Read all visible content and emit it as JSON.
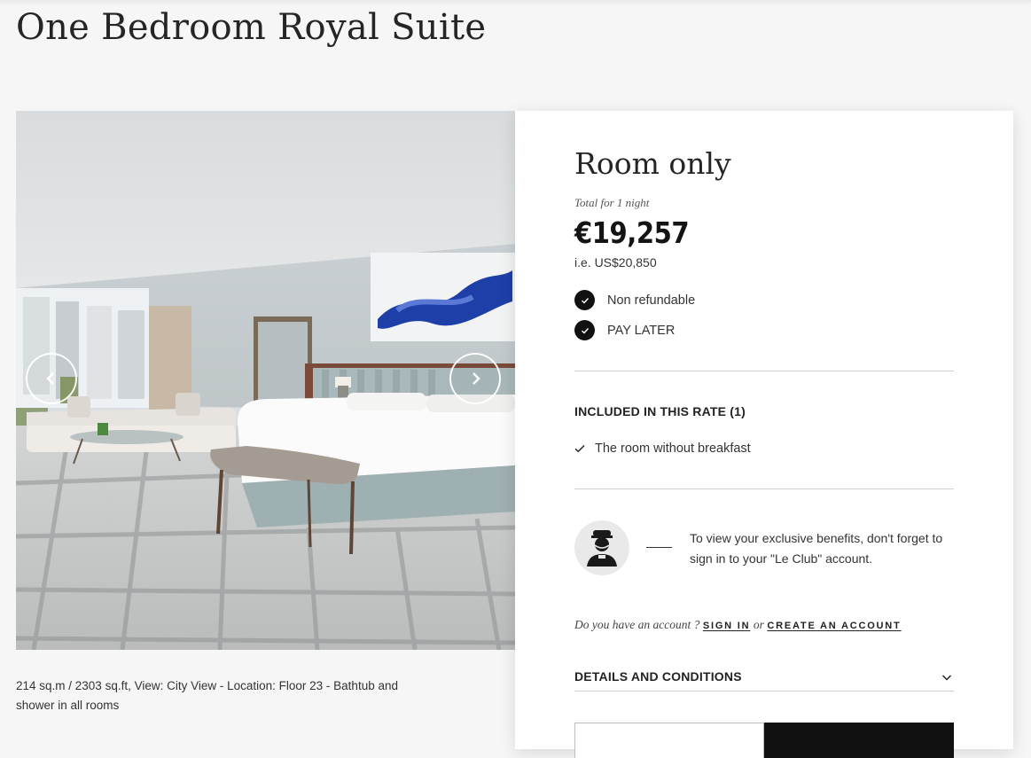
{
  "room": {
    "title": "One Bedroom Royal Suite",
    "description": "214 sq.m / 2303 sq.ft, View: City View - Location: Floor 23 - Bathtub and shower in all rooms"
  },
  "gallery": {
    "prev_icon": "chevron-left-icon",
    "next_icon": "chevron-right-icon"
  },
  "rate": {
    "name": "Room only",
    "total_label": "Total for 1 night",
    "price": "€19,257",
    "price_usd": "i.e. US$20,850",
    "conditions": [
      "Non refundable",
      "PAY LATER"
    ],
    "included_heading": "INCLUDED IN THIS RATE (1)",
    "included_items": [
      "The room without breakfast"
    ]
  },
  "club": {
    "benefits_text": "To view your exclusive benefits, don't forget to sign in to your \"Le Club\" account.",
    "account_question": "Do you have an account ?",
    "sign_in": "SIGN IN",
    "or": "or",
    "create_account": "CREATE AN ACCOUNT"
  },
  "details": {
    "label": "DETAILS AND CONDITIONS"
  },
  "colors": {
    "background": "#f6f6f7",
    "card": "#ffffff",
    "accent_dark": "#111111",
    "divider": "#cfcfcf"
  }
}
